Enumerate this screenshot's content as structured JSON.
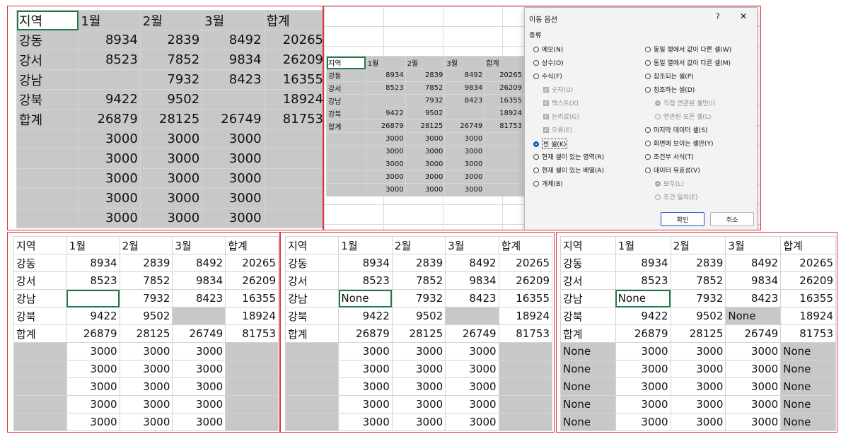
{
  "headers": [
    "지역",
    "1월",
    "2월",
    "3월",
    "합계"
  ],
  "rows": [
    [
      "강동",
      "8934",
      "2839",
      "8492",
      "20265"
    ],
    [
      "강서",
      "8523",
      "7852",
      "9834",
      "26209"
    ],
    [
      "강남",
      "",
      "7932",
      "8423",
      "16355"
    ],
    [
      "강북",
      "9422",
      "9502",
      "",
      "18924"
    ],
    [
      "합계",
      "26879",
      "28125",
      "26749",
      "81753"
    ],
    [
      "",
      "3000",
      "3000",
      "3000",
      ""
    ],
    [
      "",
      "3000",
      "3000",
      "3000",
      ""
    ],
    [
      "",
      "3000",
      "3000",
      "3000",
      ""
    ],
    [
      "",
      "3000",
      "3000",
      "3000",
      ""
    ],
    [
      "",
      "3000",
      "3000",
      "3000",
      ""
    ]
  ],
  "none_text": "None",
  "dialog": {
    "title": "이동 옵션",
    "help": "?",
    "close": "✕",
    "group": "종류",
    "left_options": [
      {
        "label": "메모(N)",
        "state": "off"
      },
      {
        "label": "상수(O)",
        "state": "off"
      },
      {
        "label": "수식(F)",
        "state": "off"
      },
      {
        "label": "숫자(U)",
        "state": "chk-dis"
      },
      {
        "label": "텍스트(X)",
        "state": "chk-dis"
      },
      {
        "label": "논리값(G)",
        "state": "chk-dis"
      },
      {
        "label": "오류(E)",
        "state": "chk-dis"
      },
      {
        "label": "빈 셀(K)",
        "state": "on"
      },
      {
        "label": "현재 셀이 있는 영역(R)",
        "state": "off"
      },
      {
        "label": "현재 셀이 있는 배열(A)",
        "state": "off"
      },
      {
        "label": "개체(B)",
        "state": "off"
      }
    ],
    "right_options": [
      {
        "label": "동일 행에서 값이 다른 셀(W)",
        "state": "off"
      },
      {
        "label": "동일 열에서 값이 다른 셀(M)",
        "state": "off"
      },
      {
        "label": "참조되는 셀(P)",
        "state": "off"
      },
      {
        "label": "참조하는 셀(D)",
        "state": "off"
      },
      {
        "label": "직접 연관된 셀만(I)",
        "state": "dis-on"
      },
      {
        "label": "연관된 모든 셀(L)",
        "state": "dis"
      },
      {
        "label": "마지막 데이터 셀(S)",
        "state": "off"
      },
      {
        "label": "화면에 보이는 셀만(Y)",
        "state": "off"
      },
      {
        "label": "조건부 서식(T)",
        "state": "off"
      },
      {
        "label": "데이터 유효성(V)",
        "state": "off"
      },
      {
        "label": "모두(L)",
        "state": "dis-on"
      },
      {
        "label": "조건 일치(E)",
        "state": "dis"
      }
    ],
    "ok": "확인",
    "cancel": "취소"
  }
}
